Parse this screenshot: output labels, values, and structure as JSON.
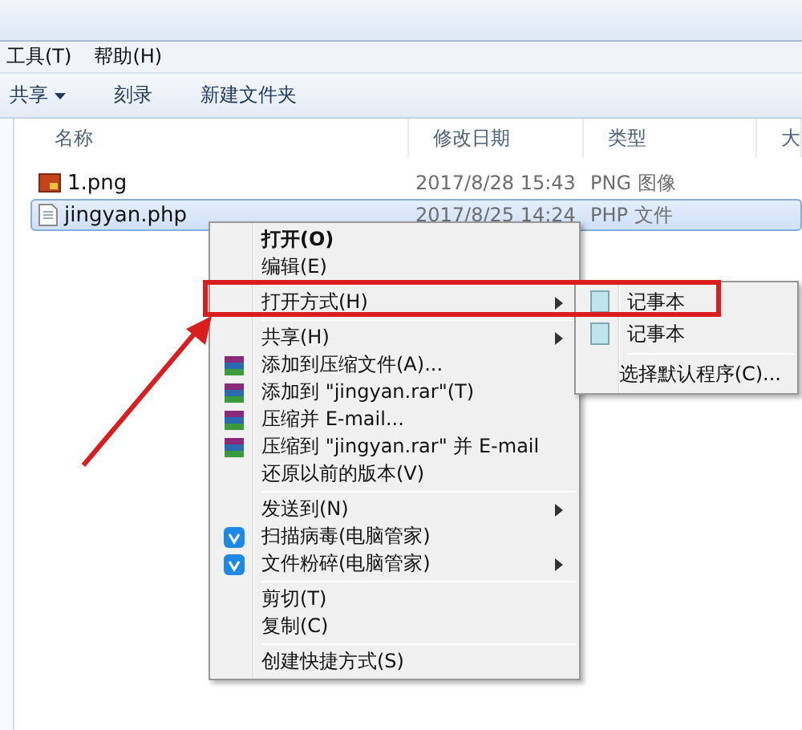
{
  "menubar": [
    {
      "label": "工具(T)"
    },
    {
      "label": "帮助(H)"
    }
  ],
  "toolbar": [
    {
      "label": "共享",
      "dropdown": true
    },
    {
      "label": "刻录",
      "dropdown": false
    },
    {
      "label": "新建文件夹",
      "dropdown": false
    }
  ],
  "columns": [
    "名称",
    "修改日期",
    "类型",
    "大"
  ],
  "files": [
    {
      "name": "1.png",
      "modified": "2017/8/28 15:43",
      "type": "PNG 图像",
      "kind": "image",
      "selected": false
    },
    {
      "name": "jingyan.php",
      "modified": "2017/8/25 14:24",
      "type": "PHP 文件",
      "kind": "text",
      "selected": true
    }
  ],
  "context_menu": {
    "items": [
      {
        "kind": "plain",
        "label": "打开(O)",
        "bold": true,
        "submenu": false
      },
      {
        "kind": "plain",
        "label": "编辑(E)",
        "bold": false,
        "submenu": false
      },
      {
        "kind": "separator"
      },
      {
        "kind": "plain",
        "label": "打开方式(H)",
        "bold": false,
        "submenu": true
      },
      {
        "kind": "separator"
      },
      {
        "kind": "plain",
        "label": "共享(H)",
        "bold": false,
        "submenu": true
      },
      {
        "kind": "archive",
        "label": "添加到压缩文件(A)...",
        "bold": false,
        "submenu": false
      },
      {
        "kind": "archive",
        "label": "添加到 \"jingyan.rar\"(T)",
        "bold": false,
        "submenu": false
      },
      {
        "kind": "archive",
        "label": "压缩并 E-mail...",
        "bold": false,
        "submenu": false
      },
      {
        "kind": "archive",
        "label": "压缩到 \"jingyan.rar\" 并 E-mail",
        "bold": false,
        "submenu": false
      },
      {
        "kind": "plain",
        "label": "还原以前的版本(V)",
        "bold": false,
        "submenu": false
      },
      {
        "kind": "separator"
      },
      {
        "kind": "plain",
        "label": "发送到(N)",
        "bold": false,
        "submenu": true
      },
      {
        "kind": "shield",
        "label": "扫描病毒(电脑管家)",
        "bold": false,
        "submenu": false
      },
      {
        "kind": "shield",
        "label": "文件粉碎(电脑管家)",
        "bold": false,
        "submenu": true
      },
      {
        "kind": "separator"
      },
      {
        "kind": "plain",
        "label": "剪切(T)",
        "bold": false,
        "submenu": false
      },
      {
        "kind": "plain",
        "label": "复制(C)",
        "bold": false,
        "submenu": false
      },
      {
        "kind": "separator"
      },
      {
        "kind": "plain",
        "label": "创建快捷方式(S)",
        "bold": false,
        "submenu": false
      }
    ]
  },
  "open_with_menu": {
    "items": [
      {
        "kind": "app",
        "label": "记事本"
      },
      {
        "kind": "app",
        "label": "记事本"
      },
      {
        "kind": "separator"
      },
      {
        "kind": "plain",
        "label": "选择默认程序(C)..."
      }
    ]
  }
}
